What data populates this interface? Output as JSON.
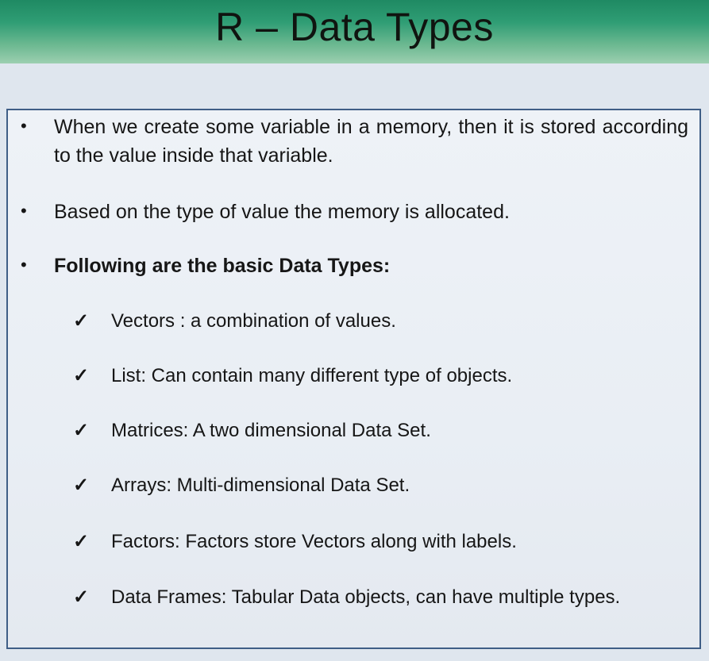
{
  "slide": {
    "title": "R – Data Types",
    "bullets": [
      {
        "symbol": "•",
        "text": "When we create some variable in a memory, then it is stored according to the value inside that variable."
      },
      {
        "symbol": "•",
        "text": "Based on the type of value the memory is allocated."
      },
      {
        "symbol": "•",
        "text": "Following are the basic Data Types:"
      }
    ],
    "data_types": [
      {
        "check": "✓",
        "text": "Vectors : a combination of values."
      },
      {
        "check": "✓",
        "text": "List: Can contain many different type of objects."
      },
      {
        "check": "✓",
        "text": "Matrices: A two dimensional Data Set."
      },
      {
        "check": "✓",
        "text": "Arrays: Multi-dimensional Data Set."
      },
      {
        "check": "✓",
        "text": "Factors: Factors store Vectors along with labels."
      },
      {
        "check": "✓",
        "text": "Data Frames: Tabular Data objects, can have  multiple types."
      }
    ]
  },
  "colors": {
    "title_bar": "#2f9d74",
    "box_border": "#3f5e86",
    "background": "#dfe6ee"
  }
}
